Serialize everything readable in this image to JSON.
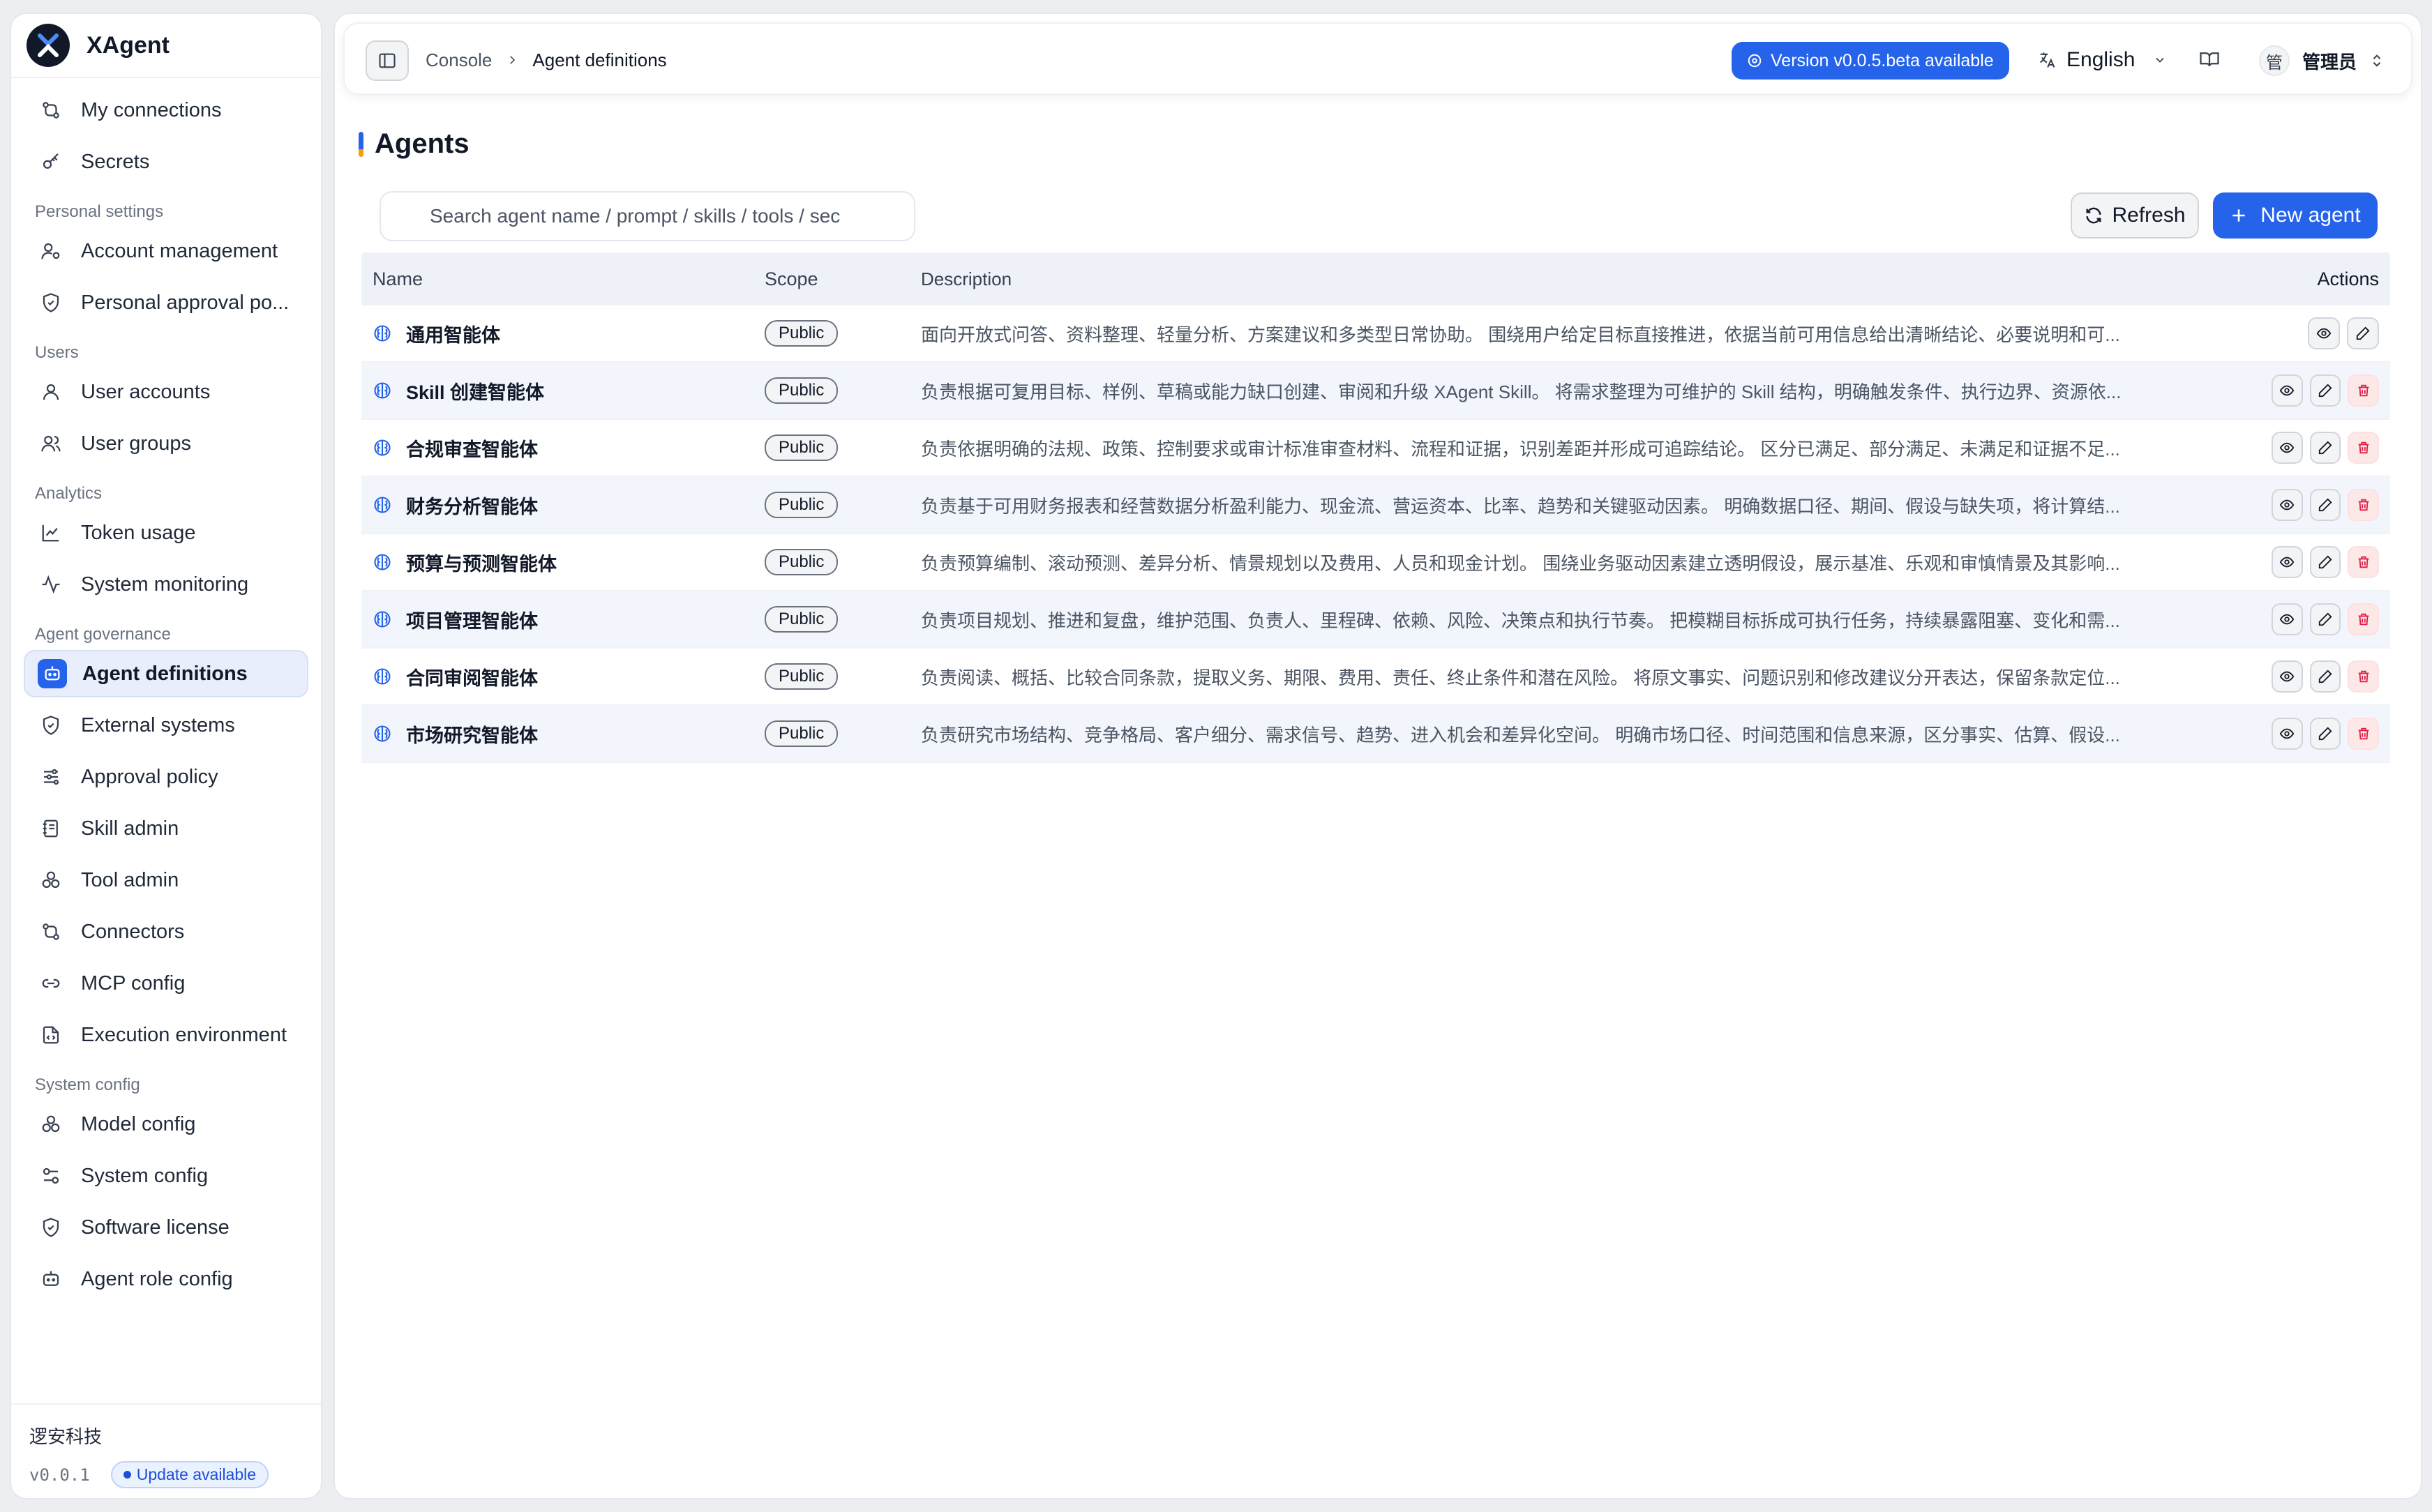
{
  "app": {
    "name": "XAgent"
  },
  "sidebar": {
    "top_items": [
      {
        "label": "My connections",
        "icon": "connections-icon"
      },
      {
        "label": "Secrets",
        "icon": "key-icon"
      }
    ],
    "sections": [
      {
        "title": "Personal settings",
        "items": [
          {
            "label": "Account management",
            "icon": "user-gear-icon"
          },
          {
            "label": "Personal approval po...",
            "icon": "shield-check-icon"
          }
        ]
      },
      {
        "title": "Users",
        "items": [
          {
            "label": "User accounts",
            "icon": "user-icon"
          },
          {
            "label": "User groups",
            "icon": "users-icon"
          }
        ]
      },
      {
        "title": "Analytics",
        "items": [
          {
            "label": "Token usage",
            "icon": "line-chart-icon"
          },
          {
            "label": "System monitoring",
            "icon": "activity-icon"
          }
        ]
      },
      {
        "title": "Agent governance",
        "items": [
          {
            "label": "Agent definitions",
            "icon": "bot-icon",
            "active": true
          },
          {
            "label": "External systems",
            "icon": "shield-icon"
          },
          {
            "label": "Approval policy",
            "icon": "sliders-icon"
          },
          {
            "label": "Skill admin",
            "icon": "notebook-icon"
          },
          {
            "label": "Tool admin",
            "icon": "boxes-icon"
          },
          {
            "label": "Connectors",
            "icon": "connectors-icon"
          },
          {
            "label": "MCP config",
            "icon": "link-icon"
          },
          {
            "label": "Execution environment",
            "icon": "file-code-icon"
          }
        ]
      },
      {
        "title": "System config",
        "items": [
          {
            "label": "Model config",
            "icon": "boxes-icon"
          },
          {
            "label": "System config",
            "icon": "settings-toggle-icon"
          },
          {
            "label": "Software license",
            "icon": "shield-check-icon"
          },
          {
            "label": "Agent role config",
            "icon": "bot-icon"
          }
        ]
      }
    ],
    "footer": {
      "company": "逻安科技",
      "version": "v0.0.1",
      "update_label": "Update available"
    }
  },
  "topbar": {
    "breadcrumb": [
      "Console",
      "Agent definitions"
    ],
    "version_button": "Version v0.0.5.beta available",
    "language": "English",
    "user_avatar": "管",
    "user_name": "管理员"
  },
  "page": {
    "title": "Agents",
    "search_placeholder": "Search agent name / prompt / skills / tools / sec",
    "refresh_label": "Refresh",
    "new_agent_label": "New agent"
  },
  "table": {
    "columns": [
      "Name",
      "Scope",
      "Description",
      "Actions"
    ],
    "rows": [
      {
        "name": "通用智能体",
        "scope": "Public",
        "description": "面向开放式问答、资料整理、轻量分析、方案建议和多类型日常协助。 围绕用户给定目标直接推进，依据当前可用信息给出清晰结论、必要说明和可...",
        "actions": [
          "view",
          "edit"
        ]
      },
      {
        "name": "Skill 创建智能体",
        "scope": "Public",
        "description": "负责根据可复用目标、样例、草稿或能力缺口创建、审阅和升级 XAgent Skill。 将需求整理为可维护的 Skill 结构，明确触发条件、执行边界、资源依...",
        "actions": [
          "view",
          "edit",
          "delete"
        ]
      },
      {
        "name": "合规审查智能体",
        "scope": "Public",
        "description": "负责依据明确的法规、政策、控制要求或审计标准审查材料、流程和证据，识别差距并形成可追踪结论。 区分已满足、部分满足、未满足和证据不足...",
        "actions": [
          "view",
          "edit",
          "delete"
        ]
      },
      {
        "name": "财务分析智能体",
        "scope": "Public",
        "description": "负责基于可用财务报表和经营数据分析盈利能力、现金流、营运资本、比率、趋势和关键驱动因素。 明确数据口径、期间、假设与缺失项，将计算结...",
        "actions": [
          "view",
          "edit",
          "delete"
        ]
      },
      {
        "name": "预算与预测智能体",
        "scope": "Public",
        "description": "负责预算编制、滚动预测、差异分析、情景规划以及费用、人员和现金计划。 围绕业务驱动因素建立透明假设，展示基准、乐观和审慎情景及其影响...",
        "actions": [
          "view",
          "edit",
          "delete"
        ]
      },
      {
        "name": "项目管理智能体",
        "scope": "Public",
        "description": "负责项目规划、推进和复盘，维护范围、负责人、里程碑、依赖、风险、决策点和执行节奏。 把模糊目标拆成可执行任务，持续暴露阻塞、变化和需...",
        "actions": [
          "view",
          "edit",
          "delete"
        ]
      },
      {
        "name": "合同审阅智能体",
        "scope": "Public",
        "description": "负责阅读、概括、比较合同条款，提取义务、期限、费用、责任、终止条件和潜在风险。 将原文事实、问题识别和修改建议分开表达，保留条款定位...",
        "actions": [
          "view",
          "edit",
          "delete"
        ]
      },
      {
        "name": "市场研究智能体",
        "scope": "Public",
        "description": "负责研究市场结构、竞争格局、客户细分、需求信号、趋势、进入机会和差异化空间。 明确市场口径、时间范围和信息来源，区分事实、估算、假设...",
        "actions": [
          "view",
          "edit",
          "delete"
        ]
      }
    ]
  },
  "colors": {
    "accent": "#2563eb",
    "danger": "#e11d48",
    "active_bg": "#e8eefb"
  }
}
